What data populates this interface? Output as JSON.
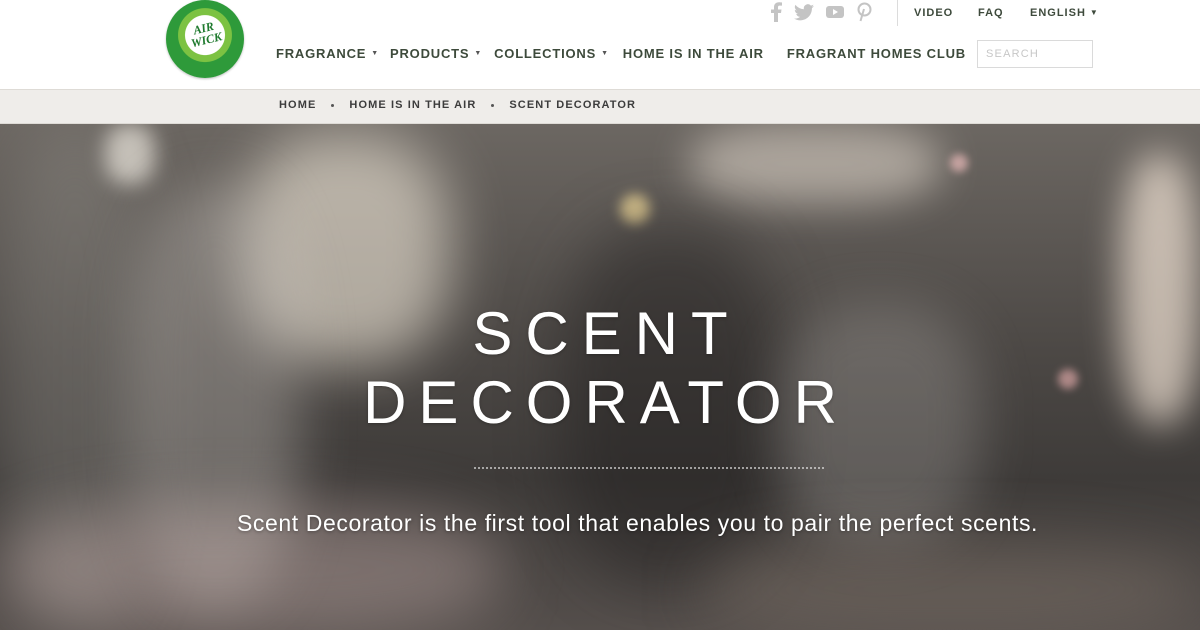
{
  "brand": {
    "logo_text": "AIR\nWICK"
  },
  "social": [
    {
      "icon": "facebook-icon"
    },
    {
      "icon": "twitter-icon"
    },
    {
      "icon": "youtube-icon"
    },
    {
      "icon": "pinterest-icon"
    }
  ],
  "utility_nav": {
    "video": "VIDEO",
    "faq": "FAQ",
    "language": "ENGLISH"
  },
  "main_nav": {
    "fragrance": "FRAGRANCE",
    "products": "PRODUCTS",
    "collections": "COLLECTIONS",
    "home_is_in_the_air": "HOME IS IN THE AIR",
    "fragrant_homes_club": "FRAGRANT HOMES CLUB"
  },
  "search": {
    "placeholder": "SEARCH"
  },
  "breadcrumb": [
    "HOME",
    "HOME IS IN THE AIR",
    "SCENT DECORATOR"
  ],
  "hero": {
    "title_line1": "SCENT",
    "title_line2": "DECORATOR",
    "description": "Scent Decorator is the first tool that enables you to pair the perfect scents."
  },
  "colors": {
    "nav_text": "#3d4a3b",
    "brand_green": "#2e9a3a",
    "breadcrumb_bg": "#efedea"
  }
}
